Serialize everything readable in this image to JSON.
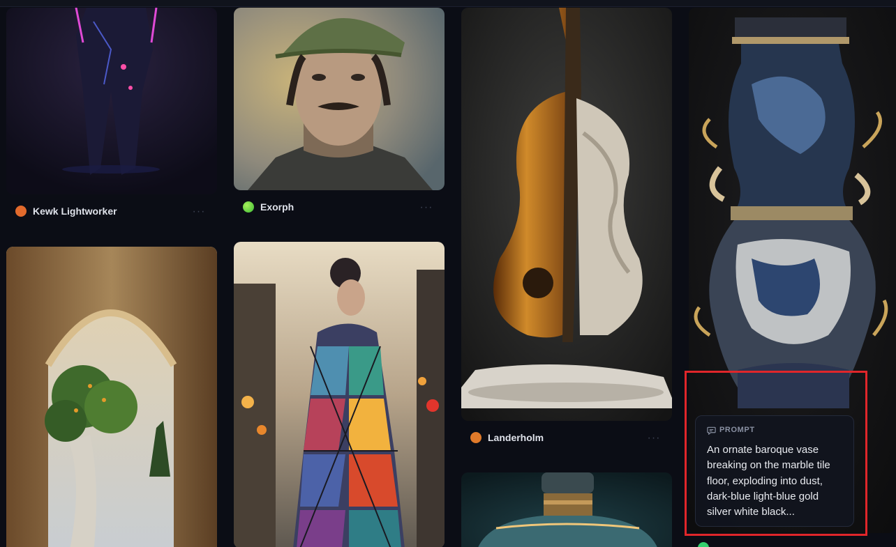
{
  "cards": [
    {
      "id": "neon-mech",
      "author": "Kewk Lightworker",
      "avatar_color": "#e26a2c",
      "more": "···"
    },
    {
      "id": "portrait",
      "author": "Exorph",
      "avatar_color": "#6fd64a",
      "more": "···"
    },
    {
      "id": "cello",
      "author": "Landerholm",
      "avatar_color": "#e07a2a",
      "more": "···"
    },
    {
      "id": "vase",
      "author": "",
      "avatar_color": "#35d06e",
      "more": ""
    },
    {
      "id": "arch",
      "author": "",
      "avatar_color": "",
      "more": ""
    },
    {
      "id": "stained-glass-dress",
      "author": "",
      "avatar_color": "",
      "more": ""
    },
    {
      "id": "bottle",
      "author": "",
      "avatar_color": "",
      "more": ""
    }
  ],
  "prompt": {
    "icon": "comment-icon",
    "label": "PROMPT",
    "text": "An ornate baroque vase breaking on the marble tile floor, exploding into dust, dark-blue light-blue gold silver white black..."
  },
  "highlight_color": "#e0262a"
}
